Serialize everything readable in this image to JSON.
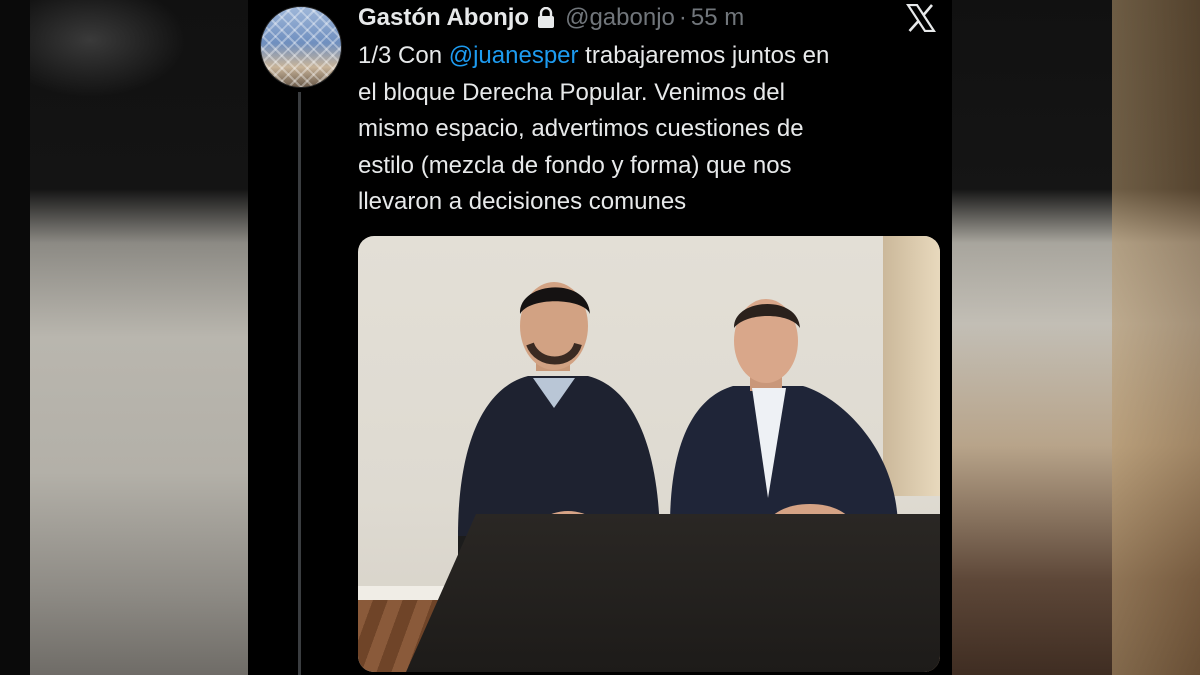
{
  "tweet": {
    "author": {
      "display_name": "Gastón Abonjo",
      "handle": "@gabonjo",
      "separator": "·",
      "time": "55 m",
      "locked": true
    },
    "text": {
      "line1_prefix": "1/3 Con ",
      "mention": "@juanesper",
      "line1_suffix": " trabajaremos juntos en",
      "line2": "el bloque Derecha Popular. Venimos del",
      "line3": "mismo espacio, advertimos cuestiones de",
      "line4": "estilo (mezcla de fondo y forma) que nos",
      "line5": "llevaron a decisiones comunes"
    },
    "platform_logo": "x-logo-icon"
  },
  "colors": {
    "background": "#000000",
    "text": "#e7e9ea",
    "secondary_text": "#71767b",
    "mention": "#1d9bf0"
  }
}
